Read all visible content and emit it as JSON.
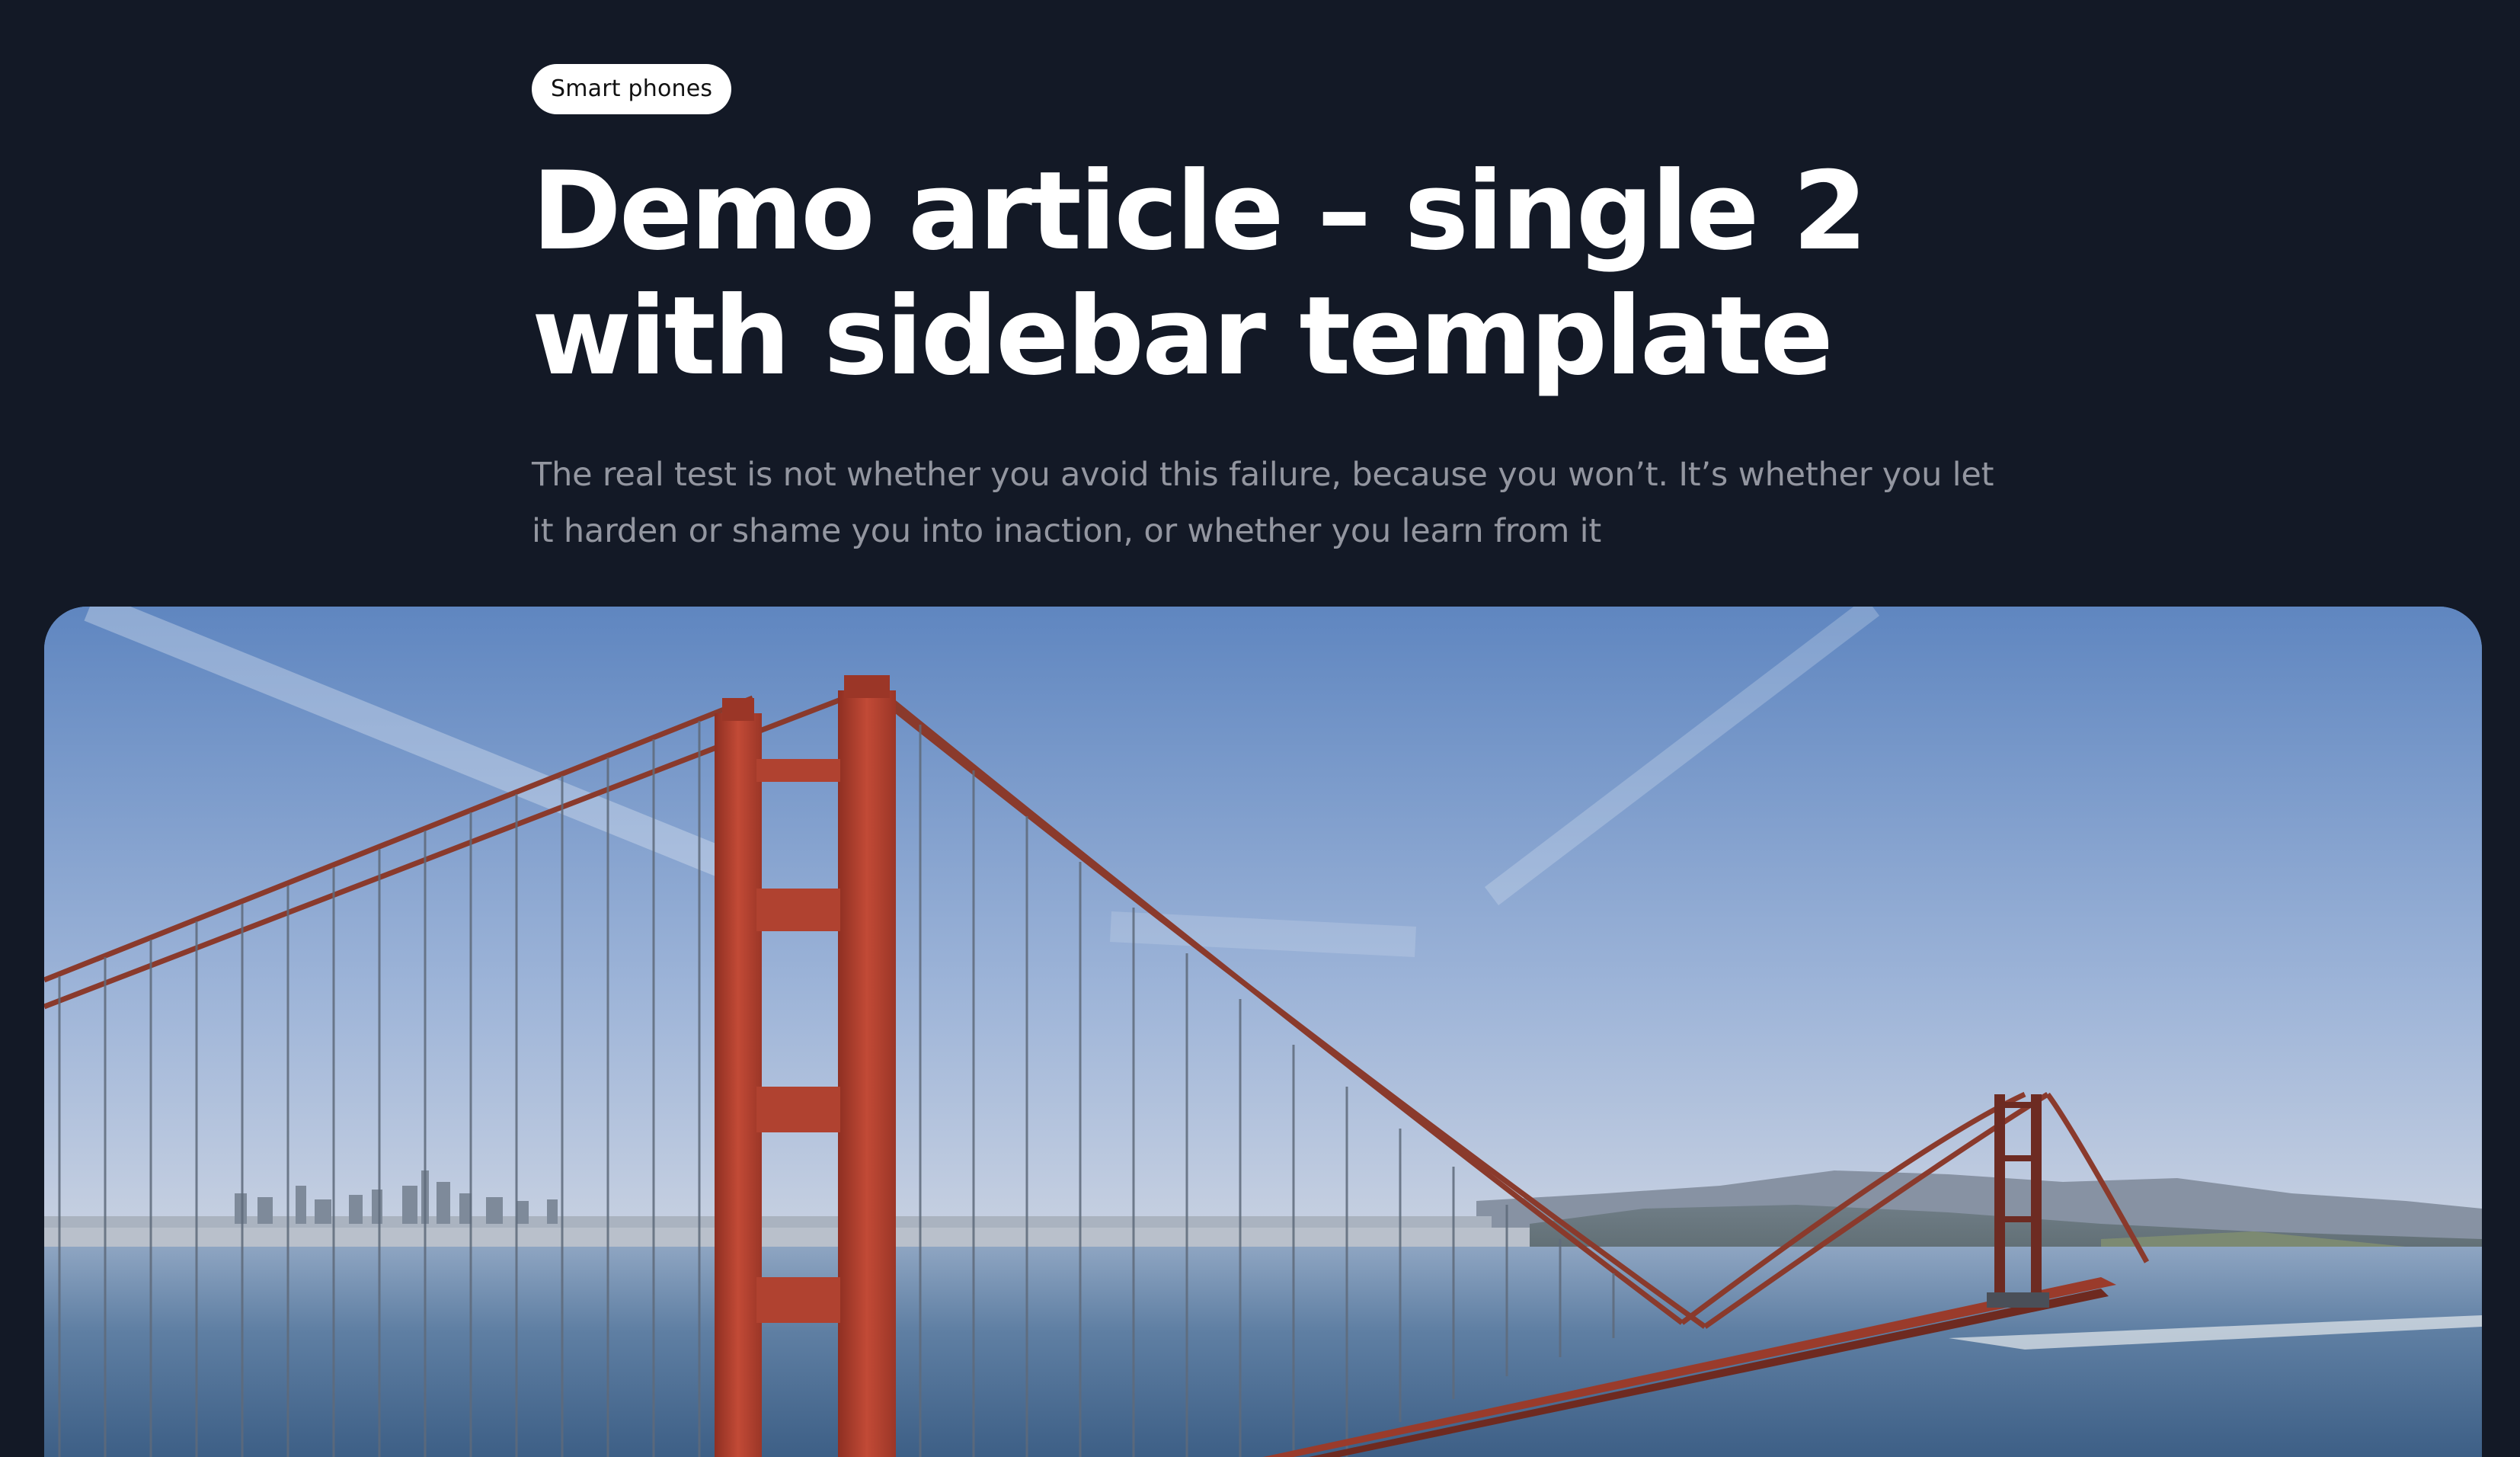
{
  "article": {
    "category": "Smart phones",
    "title": "Demo article – single 2 with sidebar template",
    "excerpt": "The real test is not whether you avoid this failure, because you won’t. It’s whether you let it harden or shame you into inaction, or whether you learn from it"
  },
  "hero_image": {
    "alt": "Golden Gate Bridge over the bay with city skyline"
  },
  "colors": {
    "background": "#131926",
    "title": "#ffffff",
    "excerpt": "#9396a0",
    "pill_background": "#ffffff",
    "bridge": "#b7432f"
  }
}
